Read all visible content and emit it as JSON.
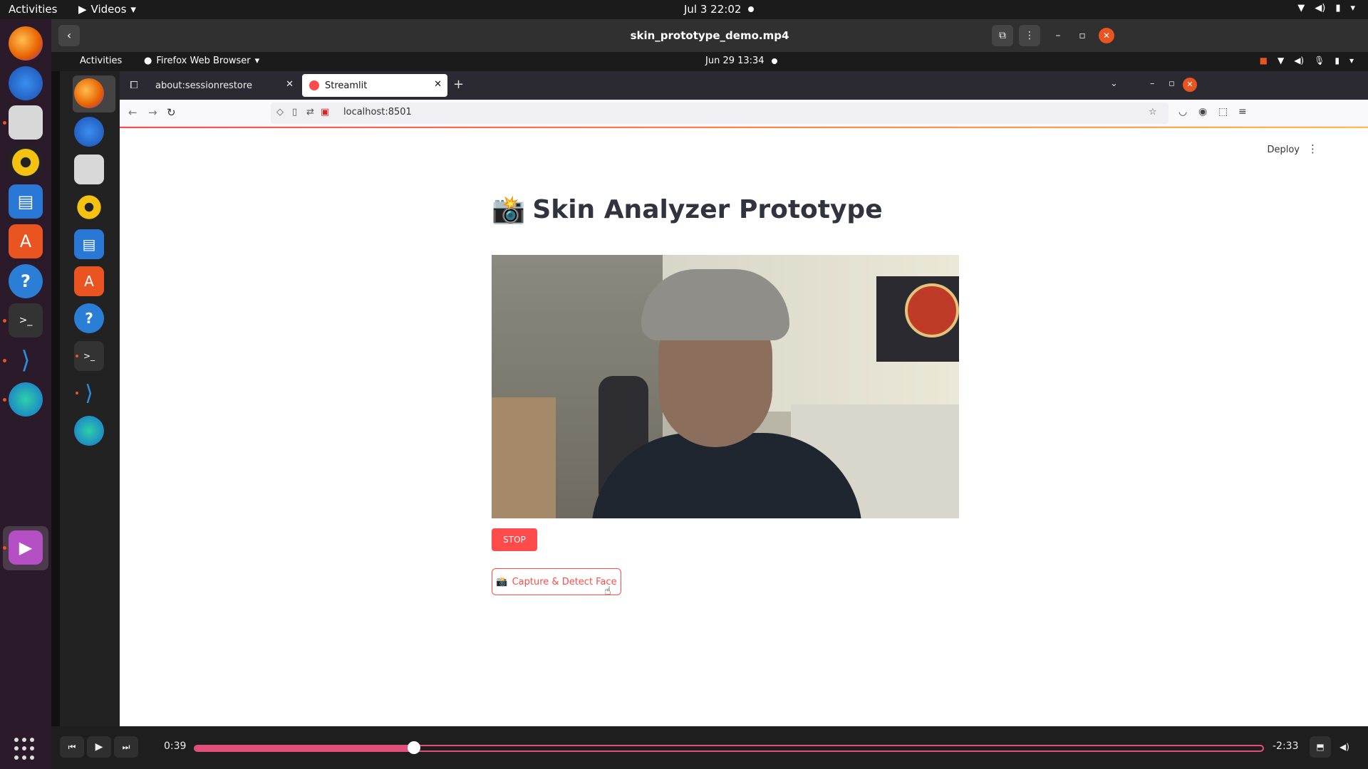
{
  "system": {
    "activities": "Activities",
    "app_name": "Videos",
    "clock": "Jul 3  22:02"
  },
  "player": {
    "title": "skin_prototype_demo.mp4",
    "elapsed": "0:39",
    "remaining": "-2:33",
    "progress_fraction": 0.205
  },
  "inner_system": {
    "activities": "Activities",
    "app_name": "Firefox Web Browser",
    "clock": "Jun 29  13:34"
  },
  "browser": {
    "tabs": [
      {
        "label": "about:sessionrestore",
        "active": false
      },
      {
        "label": "Streamlit",
        "active": true
      }
    ],
    "url": "localhost:8501"
  },
  "streamlit": {
    "deploy_label": "Deploy",
    "title_emoji": "📸",
    "title": "Skin Analyzer Prototype",
    "stop_label": "STOP",
    "capture_emoji": "📸",
    "capture_label": "Capture & Detect Face"
  },
  "colors": {
    "accent": "#ff4b4b",
    "seek": "#e0507a",
    "ubuntu_orange": "#e95420"
  },
  "icons": {
    "dock": [
      "firefox-icon",
      "thunderbird-icon",
      "files-icon",
      "rhythmbox-icon",
      "writer-icon",
      "software-icon",
      "help-icon",
      "terminal-icon",
      "vscode-icon",
      "edge-dev-icon",
      "videos-icon",
      "app-grid-icon"
    ]
  }
}
